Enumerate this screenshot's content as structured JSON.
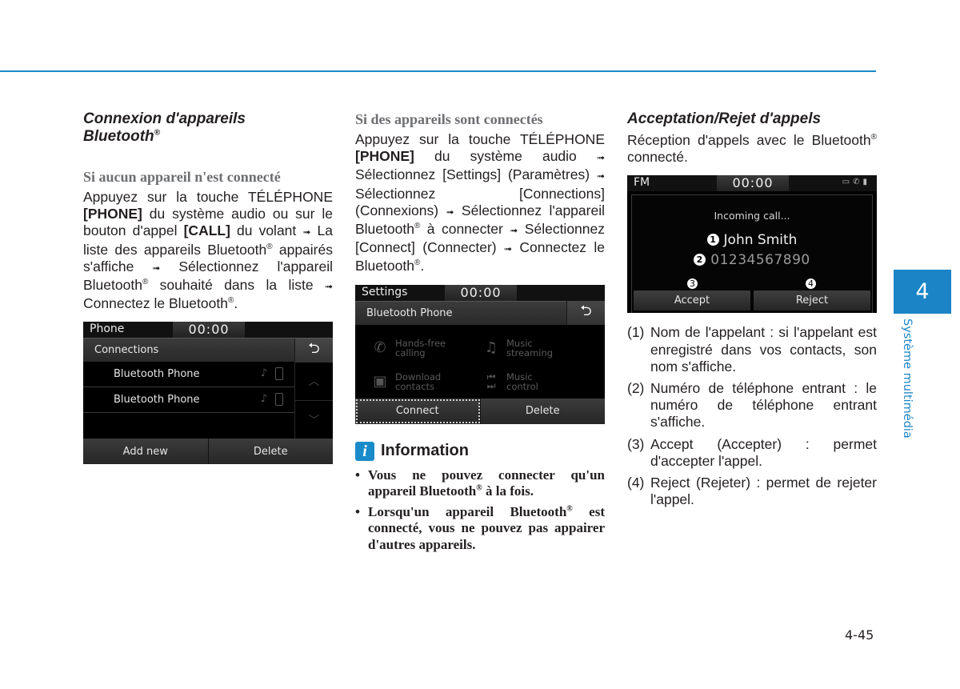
{
  "page": {
    "number": "4-45",
    "chapter_number": "4",
    "chapter_title": "Système multimédia",
    "accent_color": "#1a84c6"
  },
  "col1": {
    "title_line1": "Connexion d'appareils",
    "title_line2": "Bluetooth",
    "subtitle": "Si aucun appareil n'est connecté",
    "para": {
      "t1": "Appuyez sur la touche TÉLÉPHONE ",
      "b1": "[PHONE]",
      "t2": " du système audio ou sur le bouton d'appel ",
      "b2": "[CALL]",
      "t3": " du volant ",
      "t4": " La liste des appareils Bluetooth",
      "t5": " appairés s'affiche ",
      "t6": " Sélectionnez l'appareil Bluetooth",
      "t7": " souhaité dans la liste ",
      "t8": " Connectez le Bluetooth",
      "t9": "."
    },
    "screen": {
      "status_title": "Phone",
      "clock": "00:00",
      "header": "Connections",
      "rows": [
        {
          "label": "Bluetooth Phone"
        },
        {
          "label": "Bluetooth Phone"
        }
      ],
      "buttons": [
        "Add new",
        "Delete"
      ]
    }
  },
  "col2": {
    "subtitle": "Si des appareils sont connectés",
    "para": {
      "t1": "Appuyez sur la touche TÉLÉPHONE ",
      "b1": "[PHONE]",
      "t2": " du système audio ",
      "t3": " Sélectionnez [Settings] (Paramètres) ",
      "t4": " Sélectionnez [Connections] (Connexions) ",
      "t5": " Sélectionnez l'appareil Bluetooth",
      "t6": " à connecter ",
      "t7": " Sélectionnez [Connect] (Connecter) ",
      "t8": " Connectez le Bluetooth",
      "t9": "."
    },
    "screen": {
      "status_title": "Settings",
      "clock": "00:00",
      "header": "Bluetooth Phone",
      "features": [
        {
          "icon": "handsfree-phone-icon",
          "line1": "Hands-free",
          "line2": "calling"
        },
        {
          "icon": "music-streaming-icon",
          "line1": "Music",
          "line2": "streaming"
        },
        {
          "icon": "contacts-icon",
          "line1": "Download",
          "line2": "contacts"
        },
        {
          "icon": "track-skip-icon",
          "line1": "Music",
          "line2": "control"
        }
      ],
      "buttons": [
        "Connect",
        "Delete"
      ]
    },
    "info": {
      "title": "Information",
      "items": [
        {
          "a": "Vous ne pouvez connecter qu'un appareil Bluetooth",
          "b": " à la fois."
        },
        {
          "a": "Lorsqu'un appareil Bluetooth",
          "b": " est connecté, vous ne pouvez pas appairer d'autres appareils."
        }
      ]
    }
  },
  "col3": {
    "title": "Acceptation/Rejet d'appels",
    "intro_a": "Réception d'appels avec le Bluetooth",
    "intro_b": " connecté.",
    "screen": {
      "status_title": "FM",
      "clock": "00:00",
      "incoming_label": "Incoming call...",
      "caller_name": "John Smith",
      "caller_number": "01234567890",
      "callouts": [
        "1",
        "2",
        "3",
        "4"
      ],
      "buttons": [
        "Accept",
        "Reject"
      ]
    },
    "items": [
      {
        "n": "(1)",
        "text": "Nom de l'appelant : si l'appelant est enregistré dans vos contacts, son nom s'affiche."
      },
      {
        "n": "(2)",
        "text": "Numéro de téléphone entrant : le numéro de téléphone entrant s'affiche."
      },
      {
        "n": "(3)",
        "text": "Accept (Accepter) : permet d'accepter l'appel."
      },
      {
        "n": "(4)",
        "text": "Reject (Rejeter) : permet de rejeter l'appel."
      }
    ]
  },
  "symbols": {
    "arrow": "➟",
    "registered": "®",
    "back": "⮌",
    "up": "︿",
    "down": "﹀"
  }
}
